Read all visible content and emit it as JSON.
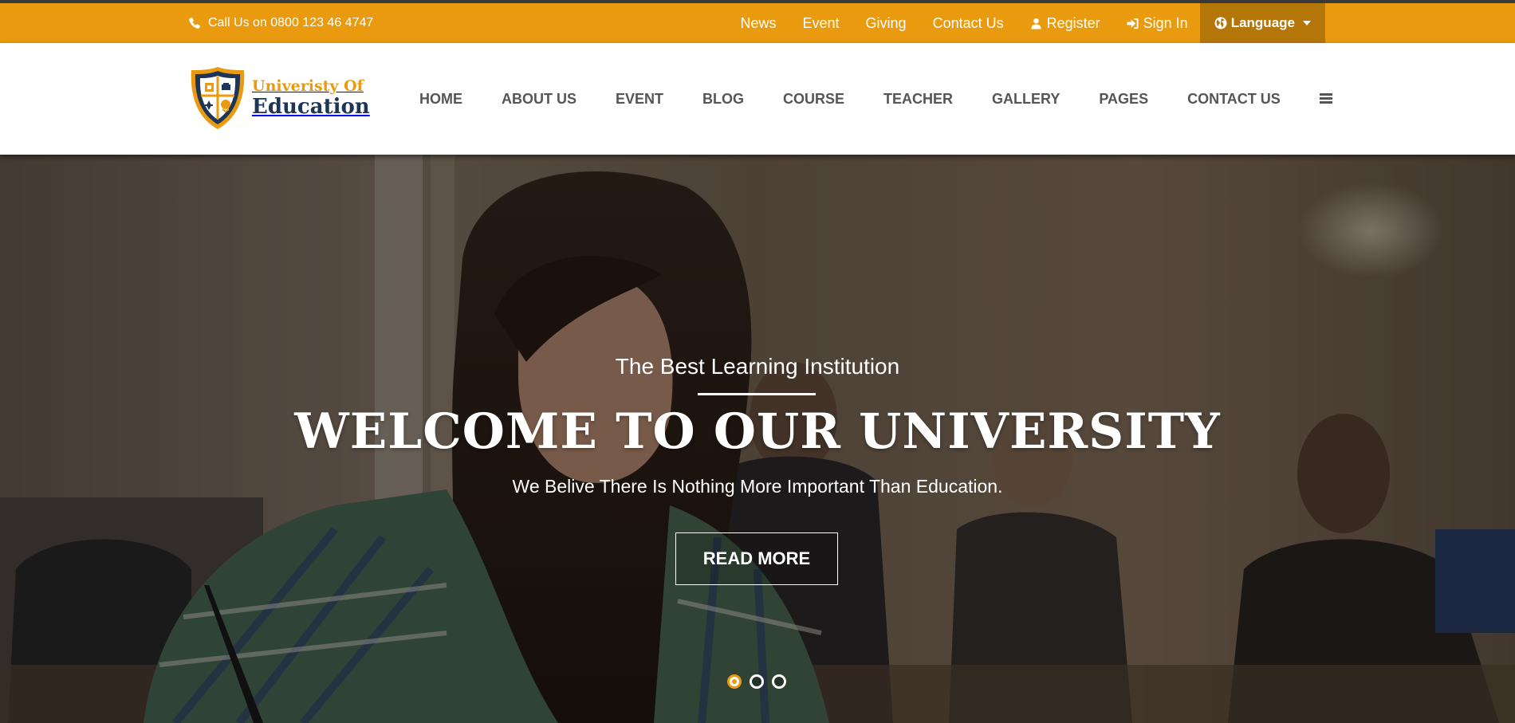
{
  "topbar": {
    "call_text": "Call Us on 0800 123 46 4747",
    "links": [
      "News",
      "Event",
      "Giving",
      "Contact Us"
    ],
    "register": "Register",
    "sign_in": "Sign In",
    "language": "Language"
  },
  "logo": {
    "line1": "Univeristy Of",
    "line2": "Education"
  },
  "nav": {
    "items": [
      "HOME",
      "ABOUT US",
      "EVENT",
      "BLOG",
      "COURSE",
      "TEACHER",
      "GALLERY",
      "PAGES",
      "CONTACT US"
    ]
  },
  "hero": {
    "subtitle": "The Best Learning Institution",
    "headline": "WELCOME TO OUR UNIVERSITY",
    "tagline": "We Belive There Is Nothing More Important Than Education.",
    "button": "READ MORE",
    "slide_count": 3,
    "active_slide": 1
  },
  "colors": {
    "accent": "#e99a0f",
    "accent_dark": "#b57609",
    "nav_text": "#555555",
    "logo_navy": "#1d3557"
  },
  "icons": {
    "phone": "phone-icon",
    "register": "user-icon",
    "sign_in": "sign-in-icon",
    "language": "globe-icon",
    "menu": "hamburger-menu-icon"
  }
}
